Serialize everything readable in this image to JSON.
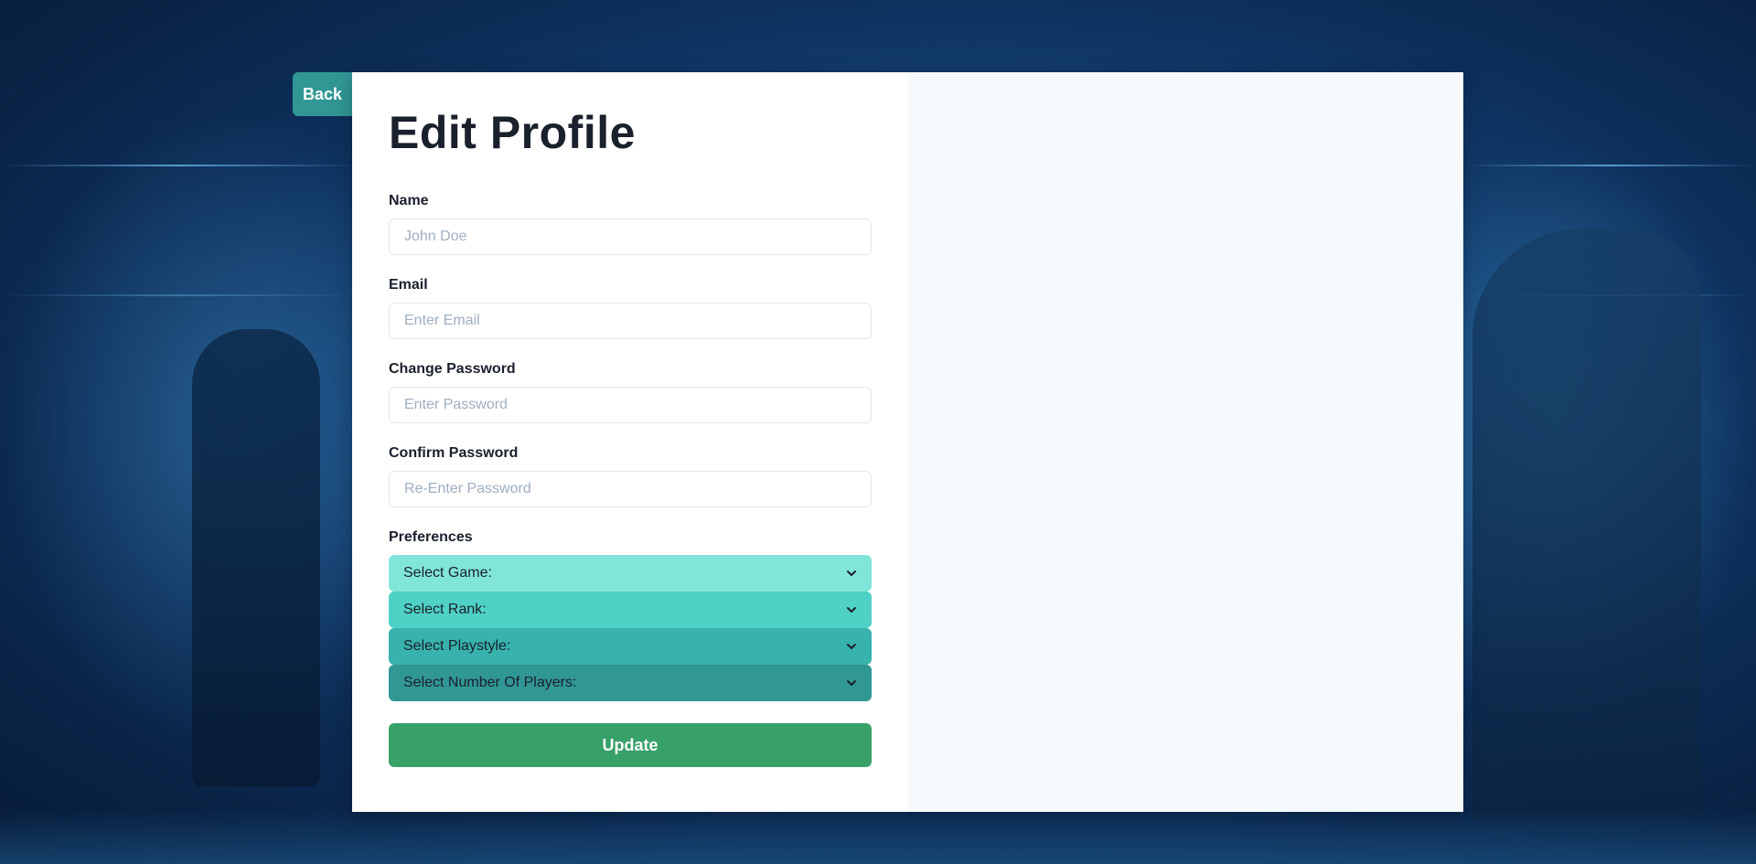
{
  "nav": {
    "back_label": "Back"
  },
  "form": {
    "title": "Edit Profile",
    "fields": [
      {
        "label": "Name",
        "placeholder": "John Doe",
        "value": ""
      },
      {
        "label": "Email",
        "placeholder": "Enter Email",
        "value": ""
      },
      {
        "label": "Change Password",
        "placeholder": "Enter Password",
        "value": ""
      },
      {
        "label": "Confirm Password",
        "placeholder": "Re-Enter Password",
        "value": ""
      }
    ],
    "preferences": {
      "label": "Preferences",
      "selects": [
        {
          "label": "Select Game:",
          "icon": "chevron-down-icon"
        },
        {
          "label": "Select Rank:",
          "icon": "chevron-down-icon"
        },
        {
          "label": "Select Playstyle:",
          "icon": "chevron-down-icon"
        },
        {
          "label": "Select Number Of Players:",
          "icon": "chevron-down-icon"
        }
      ]
    },
    "submit_label": "Update"
  },
  "colors": {
    "back_button": "#319795",
    "select_1": "#81e6d9",
    "select_2": "#4fd1c5",
    "select_3": "#38b2ac",
    "select_4": "#319795",
    "update_button": "#38a169",
    "right_panel": "#f7fafc"
  }
}
